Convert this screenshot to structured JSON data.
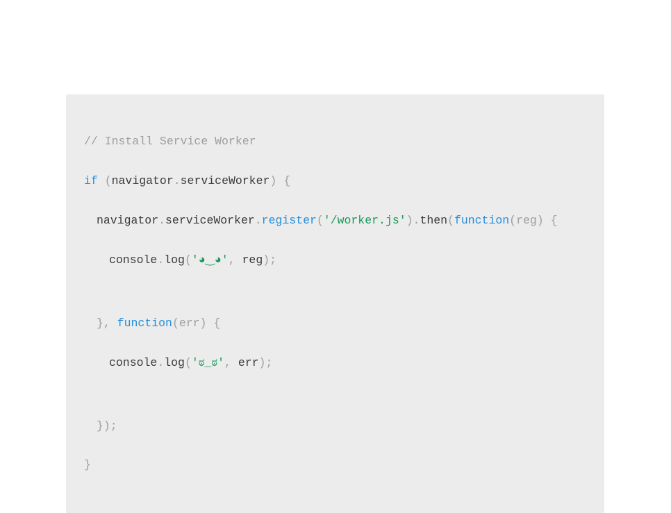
{
  "code": {
    "comment": "// Install Service Worker",
    "l2": {
      "if": "if",
      "open": " (",
      "nav": "navigator",
      "dot1": ".",
      "sw": "serviceWorker",
      "close": ") {"
    },
    "l3": {
      "nav": "navigator",
      "dot1": ".",
      "sw": "serviceWorker",
      "dot2": ".",
      "register": "register",
      "paren_open": "(",
      "path": "'/worker.js'",
      "paren_close": ")",
      "dot3": ".",
      "then": "then",
      "then_open": "(",
      "fn": "function",
      "fn_args": "(reg) {"
    },
    "l4": {
      "console": "console",
      "dot": ".",
      "log": "log",
      "open": "(",
      "str": "'◕‿◕'",
      "comma": ", ",
      "arg": "reg",
      "close": ");"
    },
    "l5": {
      "close": "}, ",
      "fn": "function",
      "args": "(err) {"
    },
    "l6": {
      "console": "console",
      "dot": ".",
      "log": "log",
      "open": "(",
      "str": "'ಠ_ಠ'",
      "comma": ", ",
      "arg": "err",
      "close": ");"
    },
    "l7": "});",
    "l8": "}"
  }
}
